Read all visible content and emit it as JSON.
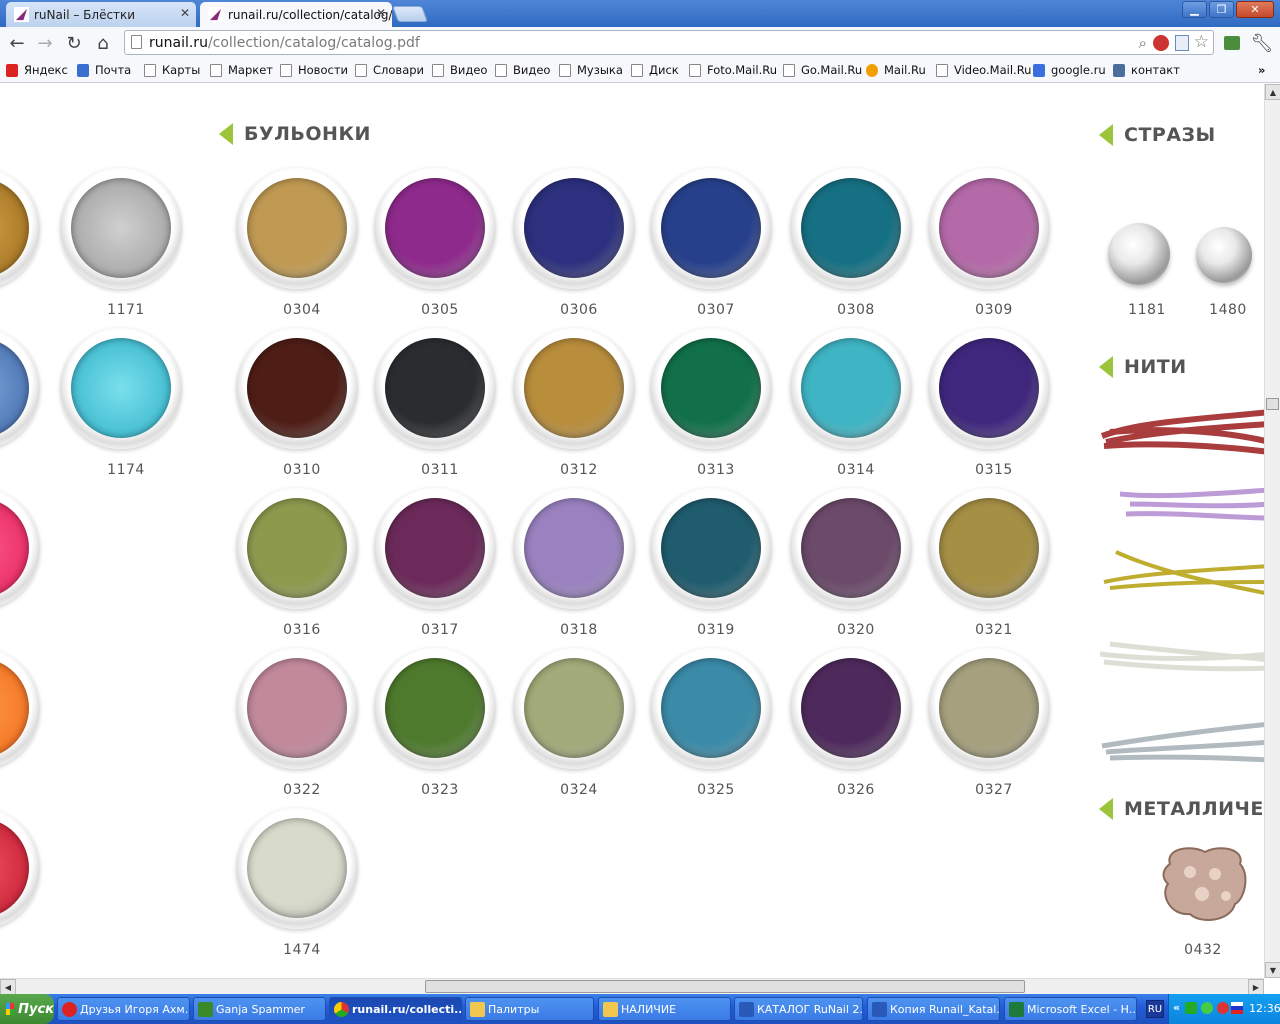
{
  "tabs": [
    {
      "title": "ruNail – Блёстки",
      "active": false
    },
    {
      "title": "runail.ru/collection/catalog/c",
      "active": true
    }
  ],
  "window_controls": {
    "minimize": "▁",
    "maximize": "❐",
    "close": "✕"
  },
  "toolbar": {
    "url_host": "runail.ru",
    "url_path": "/collection/catalog/catalog.pdf"
  },
  "bookmarks": [
    "Яндекс",
    "Почта",
    "Карты",
    "Маркет",
    "Новости",
    "Словари",
    "Видео",
    "Видео",
    "Музыка",
    "Диск",
    "Foto.Mail.Ru",
    "Go.Mail.Ru",
    "Mail.Ru",
    "Video.Mail.Ru",
    "google.ru",
    "контакт"
  ],
  "catalog": {
    "left_codes": [
      "1171",
      "1174"
    ],
    "sections": {
      "bullonki": "БУЛЬОНКИ",
      "strazy": "СТРАЗЫ",
      "niti": "НИТИ",
      "metall": "МЕТАЛЛИЧЕСК"
    },
    "bullonki_codes": [
      [
        "0304",
        "0305",
        "0306",
        "0307",
        "0308",
        "0309"
      ],
      [
        "0310",
        "0311",
        "0312",
        "0313",
        "0314",
        "0315"
      ],
      [
        "0316",
        "0317",
        "0318",
        "0319",
        "0320",
        "0321"
      ],
      [
        "0322",
        "0323",
        "0324",
        "0325",
        "0326",
        "0327"
      ],
      [
        "1474"
      ]
    ],
    "bullonki_colors": [
      [
        "#c09a52",
        "#8e2a8c",
        "#2c307e",
        "#27408c",
        "#167083",
        "#b46aa8"
      ],
      [
        "#4e1d16",
        "#2a2d30",
        "#b88d3c",
        "#11704a",
        "#3fb4c4",
        "#3f277e"
      ],
      [
        "#8d9a4d",
        "#6b2a5a",
        "#9a82c0",
        "#1f5c6e",
        "#6b4a6a",
        "#a58f45"
      ],
      [
        "#c2899b",
        "#4e7a2d",
        "#a2ab79",
        "#3a8aa8",
        "#4e2a5c",
        "#a6a07e"
      ],
      [
        "#d8dacb"
      ]
    ],
    "strazy_codes": [
      "1181",
      "1480"
    ],
    "metall_code": "0432"
  },
  "taskbar": {
    "start": "Пуск",
    "tasks": [
      "Друзья Игоря Ахм...",
      "Ganja Spammer",
      "runail.ru/collecti...",
      "Палитры",
      "НАЛИЧИЕ",
      "КАТАЛОГ RuNail 2...",
      "Копия Runail_Katal...",
      "Microsoft Excel - Н..."
    ],
    "lang": "RU",
    "clock": "12:36"
  },
  "colors": {
    "accent_green": "#9bc43a",
    "title_gray": "#555555"
  }
}
